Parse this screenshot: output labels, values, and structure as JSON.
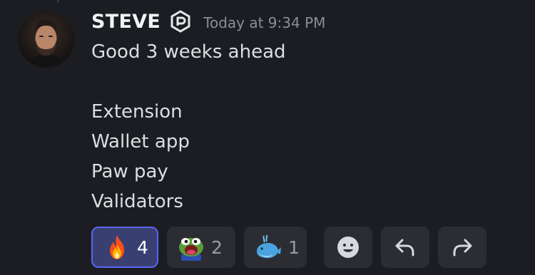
{
  "message": {
    "author": "STEVE",
    "timestamp": "Today at 9:34 PM",
    "lines": [
      "Good 3 weeks ahead",
      "",
      "Extension",
      "Wallet app",
      "Paw pay",
      "Validators"
    ]
  },
  "reactions": [
    {
      "emoji": "fire-emoji",
      "count": "4",
      "active": true
    },
    {
      "emoji": "pepe-poggers-emoji",
      "count": "2",
      "active": false
    },
    {
      "emoji": "whale-emoji",
      "count": "1",
      "active": false
    }
  ],
  "actions": [
    {
      "icon": "add-reaction-icon"
    },
    {
      "icon": "reply-icon"
    },
    {
      "icon": "forward-icon"
    }
  ],
  "colors": {
    "background": "#1c1d22",
    "reaction_active_bg": "#3a3f72",
    "reaction_active_border": "#5865f2",
    "pill_bg": "#2b2d33"
  }
}
